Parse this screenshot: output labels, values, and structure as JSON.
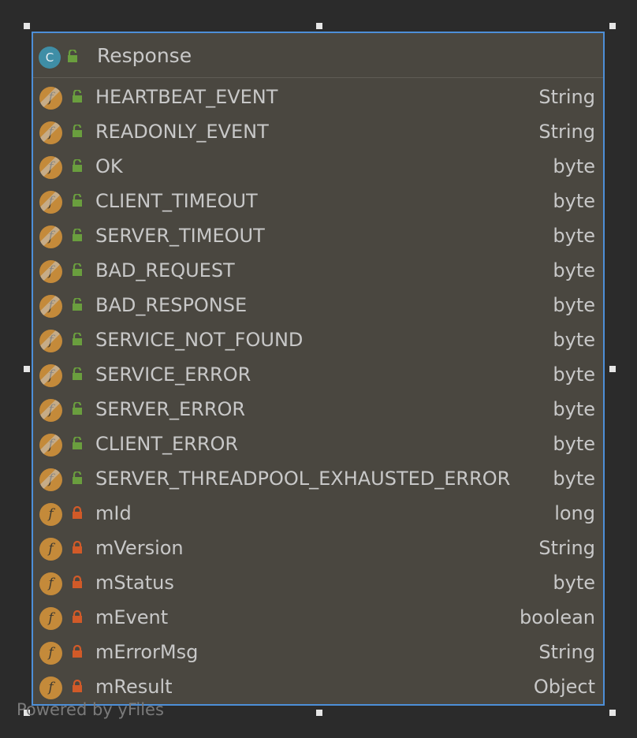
{
  "class_node": {
    "icon_letter": "C",
    "name": "Response",
    "visibility": "public",
    "fields": [
      {
        "name": "HEARTBEAT_EVENT",
        "type": "String",
        "visibility": "public",
        "static": true
      },
      {
        "name": "READONLY_EVENT",
        "type": "String",
        "visibility": "public",
        "static": true
      },
      {
        "name": "OK",
        "type": "byte",
        "visibility": "public",
        "static": true
      },
      {
        "name": "CLIENT_TIMEOUT",
        "type": "byte",
        "visibility": "public",
        "static": true
      },
      {
        "name": "SERVER_TIMEOUT",
        "type": "byte",
        "visibility": "public",
        "static": true
      },
      {
        "name": "BAD_REQUEST",
        "type": "byte",
        "visibility": "public",
        "static": true
      },
      {
        "name": "BAD_RESPONSE",
        "type": "byte",
        "visibility": "public",
        "static": true
      },
      {
        "name": "SERVICE_NOT_FOUND",
        "type": "byte",
        "visibility": "public",
        "static": true
      },
      {
        "name": "SERVICE_ERROR",
        "type": "byte",
        "visibility": "public",
        "static": true
      },
      {
        "name": "SERVER_ERROR",
        "type": "byte",
        "visibility": "public",
        "static": true
      },
      {
        "name": "CLIENT_ERROR",
        "type": "byte",
        "visibility": "public",
        "static": true
      },
      {
        "name": "SERVER_THREADPOOL_EXHAUSTED_ERROR",
        "type": "byte",
        "visibility": "public",
        "static": true
      },
      {
        "name": "mId",
        "type": "long",
        "visibility": "private",
        "static": false
      },
      {
        "name": "mVersion",
        "type": "String",
        "visibility": "private",
        "static": false
      },
      {
        "name": "mStatus",
        "type": "byte",
        "visibility": "private",
        "static": false
      },
      {
        "name": "mEvent",
        "type": "boolean",
        "visibility": "private",
        "static": false
      },
      {
        "name": "mErrorMsg",
        "type": "String",
        "visibility": "private",
        "static": false
      },
      {
        "name": "mResult",
        "type": "Object",
        "visibility": "private",
        "static": false
      }
    ],
    "field_icon_letter": "f"
  },
  "watermark": "Powered by yFiles",
  "colors": {
    "background": "#2b2b2b",
    "node_fill": "#4a4740",
    "selection_border": "#4d8fd8",
    "public_lock": "#6a9e3e",
    "private_lock": "#d15a28",
    "field_icon": "#c48a3a",
    "class_icon": "#3f8ea6"
  }
}
